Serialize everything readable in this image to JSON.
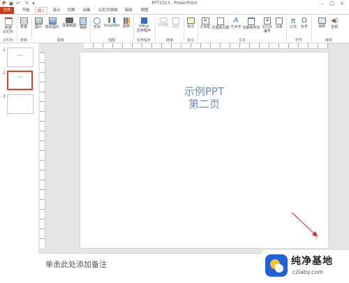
{
  "window": {
    "title": "PPT2013 - PowerPoint"
  },
  "tabs": [
    "文件",
    "开始",
    "插入",
    "设计",
    "切换",
    "动画",
    "幻灯片放映",
    "审阅",
    "视图"
  ],
  "active_tab": "插入",
  "ribbon": {
    "buttons": [
      {
        "label": "新建\n幻灯片",
        "icon": "new-slide-icon"
      },
      {
        "label": "表格",
        "icon": "table-icon"
      },
      {
        "label": "图片",
        "icon": "picture-icon"
      },
      {
        "label": "联机图片",
        "icon": "online-picture-icon"
      },
      {
        "label": "屏幕截图",
        "icon": "screenshot-icon"
      },
      {
        "label": "相册",
        "icon": "album-icon"
      },
      {
        "label": "形状",
        "icon": "shapes-icon"
      },
      {
        "label": "SmartArt",
        "icon": "smartart-icon"
      },
      {
        "label": "图表",
        "icon": "chart-icon"
      },
      {
        "label": "Office\n应用程序",
        "icon": "office-app-icon"
      },
      {
        "label": "超链接",
        "icon": "hyperlink-icon"
      },
      {
        "label": "动作",
        "icon": "action-icon"
      },
      {
        "label": "批注",
        "icon": "comment-icon"
      },
      {
        "label": "文本框",
        "icon": "textbox-icon"
      },
      {
        "label": "页眉和页脚",
        "icon": "header-footer-icon"
      },
      {
        "label": "艺术字",
        "icon": "wordart-icon"
      },
      {
        "label": "日期和时间",
        "icon": "datetime-icon"
      },
      {
        "label": "幻灯片\n编号",
        "icon": "slide-number-icon"
      },
      {
        "label": "对象",
        "icon": "object-icon"
      },
      {
        "label": "公式",
        "icon": "equation-icon"
      },
      {
        "label": "符号",
        "icon": "symbol-icon"
      },
      {
        "label": "视频",
        "icon": "video-icon"
      },
      {
        "label": "音频",
        "icon": "audio-icon"
      }
    ],
    "groups": [
      "幻灯片",
      "表格",
      "图像",
      "插图",
      "应用程序",
      "链接",
      "批注",
      "文本",
      "符号",
      "媒体"
    ]
  },
  "thumbnails": [
    {
      "num": "1",
      "text": "示例PPT"
    },
    {
      "num": "2",
      "text": "示例PPT"
    },
    {
      "num": "3",
      "text": ""
    }
  ],
  "slide": {
    "title_line1": "示例PPT",
    "title_line2": "第二页",
    "number": "2"
  },
  "notes": {
    "placeholder": "单击此处添加备注"
  },
  "watermark": {
    "name": "纯净基地",
    "url": "czlaby.com"
  },
  "colors": {
    "accent": "#c43e1c",
    "title": "#6f8bbd",
    "selection": "#d24726",
    "arrow": "#e02020"
  }
}
